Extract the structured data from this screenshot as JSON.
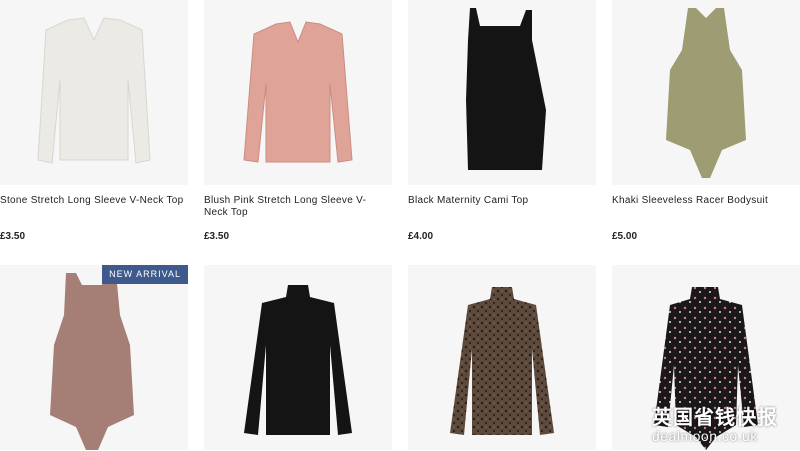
{
  "products": [
    {
      "name": "Stone Stretch Long Sleeve V-Neck Top",
      "price": "£3.50",
      "image": "stone-long-sleeve-vneck-top",
      "color": "#eceae5"
    },
    {
      "name": "Blush Pink Stretch Long Sleeve V-Neck Top",
      "price": "£3.50",
      "image": "blush-pink-long-sleeve-vneck-top",
      "color": "#dfa397"
    },
    {
      "name": "Black Maternity Cami Top",
      "price": "£4.00",
      "image": "black-maternity-cami-top",
      "color": "#141414"
    },
    {
      "name": "Khaki Sleeveless Racer Bodysuit",
      "price": "£5.00",
      "image": "khaki-racer-bodysuit",
      "color": "#9d9c72"
    },
    {
      "name": "",
      "price": "",
      "image": "mauve-racer-bodysuit",
      "color": "#a57f75",
      "badge": "NEW ARRIVAL"
    },
    {
      "name": "",
      "price": "",
      "image": "black-turtleneck-long-sleeve-top",
      "color": "#141414"
    },
    {
      "name": "",
      "price": "",
      "image": "leopard-print-turtleneck-top",
      "color": "#4d3f36"
    },
    {
      "name": "",
      "price": "",
      "image": "floral-print-high-neck-bodysuit",
      "color": "#1b1819"
    }
  ],
  "colors": {
    "card_bg": "#f6f6f6",
    "badge_bg": "#3e5a8c",
    "text": "#222222"
  },
  "watermark": {
    "chinese": "英国省钱快报",
    "site": "dealmoon.co.uk"
  }
}
